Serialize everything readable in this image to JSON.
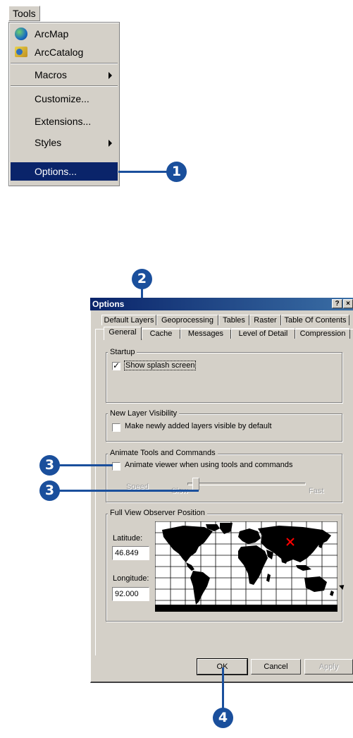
{
  "tools_menu": {
    "title": "Tools",
    "items": [
      {
        "label": "ArcMap",
        "icon": "arcmap-globe-icon"
      },
      {
        "label": "ArcCatalog",
        "icon": "arccatalog-icon"
      },
      {
        "label": "Macros",
        "submenu": true
      },
      {
        "label": "Customize..."
      },
      {
        "label": "Extensions..."
      },
      {
        "label": "Styles",
        "submenu": true
      },
      {
        "label": "Options...",
        "selected": true
      }
    ]
  },
  "callouts": [
    "1",
    "2",
    "3",
    "3",
    "4"
  ],
  "dialog": {
    "title": "Options",
    "help_label": "?",
    "close_label": "×",
    "tabs_back": [
      "Default Layers",
      "Geoprocessing",
      "Tables",
      "Raster",
      "Table Of Contents"
    ],
    "tabs_front": [
      "General",
      "Cache",
      "Messages",
      "Level of Detail",
      "Compression"
    ],
    "active_tab": "General",
    "startup": {
      "group_label": "Startup",
      "show_splash_label": "Show splash screen",
      "show_splash_checked": true
    },
    "layer_visibility": {
      "group_label": "New Layer Visibility",
      "make_visible_label": "Make newly added layers visible by default",
      "make_visible_checked": false
    },
    "animate": {
      "group_label": "Animate Tools and Commands",
      "animate_label": "Animate viewer when using tools and commands",
      "animate_checked": false,
      "speed_label": "Speed",
      "slow_label": "Slow",
      "fast_label": "Fast",
      "speed_fraction": 0.07
    },
    "observer": {
      "group_label": "Full View Observer Position",
      "latitude_label": "Latitude:",
      "latitude_value": "46.849",
      "longitude_label": "Longitude:",
      "longitude_value": "92.000"
    },
    "buttons": {
      "ok": "OK",
      "cancel": "Cancel",
      "apply": "Apply"
    }
  }
}
